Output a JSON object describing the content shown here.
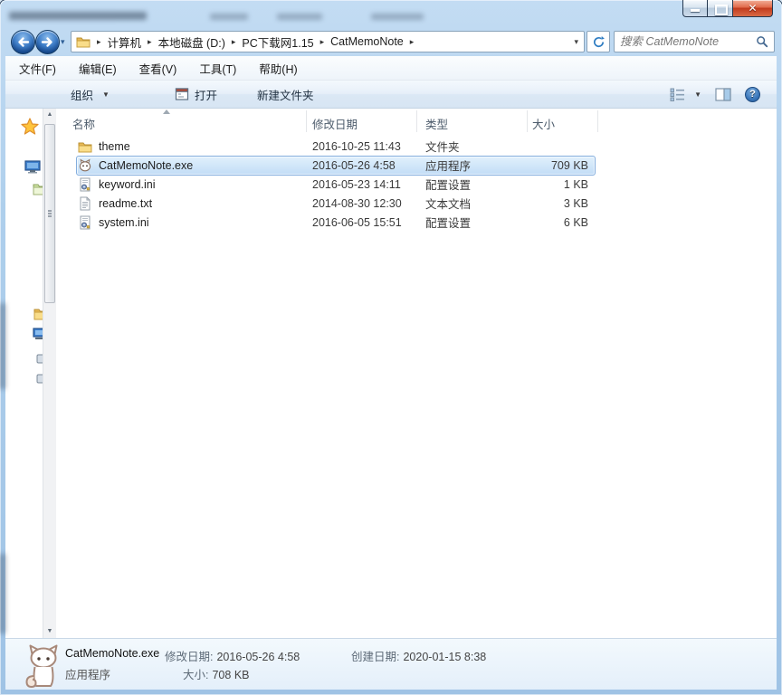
{
  "window": {
    "note": "title text is blurred/illegible in source"
  },
  "address_bar": {
    "breadcrumb": {
      "folder_icon": "folder-icon",
      "items": [
        {
          "label": "计算机"
        },
        {
          "label": "本地磁盘 (D:)"
        },
        {
          "label": "PC下载网1.15"
        },
        {
          "label": "CatMemoNote"
        }
      ]
    },
    "search_placeholder": "搜索 CatMemoNote"
  },
  "menu_bar": {
    "items": [
      "文件(F)",
      "编辑(E)",
      "查看(V)",
      "工具(T)",
      "帮助(H)"
    ]
  },
  "toolbar": {
    "organize_label": "组织",
    "open_label": "打开",
    "new_folder_label": "新建文件夹",
    "right_icons": [
      "views-icon",
      "preview-pane-icon",
      "help-icon"
    ]
  },
  "sidebar": {
    "icons": [
      "favorites-star-icon",
      "desktop-icon",
      "libraries-icon",
      "folder-icon",
      "computer-icon"
    ]
  },
  "file_list": {
    "columns": [
      "名称",
      "修改日期",
      "类型",
      "大小"
    ],
    "sort": {
      "column": "名称",
      "direction": "ascending"
    },
    "files": [
      {
        "name": "theme",
        "date": "2016-10-25 11:43",
        "type": "文件夹",
        "size": "",
        "icon": "folder-icon",
        "selected": false
      },
      {
        "name": "CatMemoNote.exe",
        "date": "2016-05-26 4:58",
        "type": "应用程序",
        "size": "709 KB",
        "icon": "cat-app-icon",
        "selected": true
      },
      {
        "name": "keyword.ini",
        "date": "2016-05-23 14:11",
        "type": "配置设置",
        "size": "1 KB",
        "icon": "ini-config-icon",
        "selected": false
      },
      {
        "name": "readme.txt",
        "date": "2014-08-30 12:30",
        "type": "文本文档",
        "size": "3 KB",
        "icon": "text-file-icon",
        "selected": false
      },
      {
        "name": "system.ini",
        "date": "2016-06-05 15:51",
        "type": "配置设置",
        "size": "6 KB",
        "icon": "ini-config-icon",
        "selected": false
      }
    ]
  },
  "details_pane": {
    "file_name": "CatMemoNote.exe",
    "file_type": "应用程序",
    "modified_label": "修改日期:",
    "modified_value": "2016-05-26 4:58",
    "created_label": "创建日期:",
    "created_value": "2020-01-15 8:38",
    "size_label": "大小:",
    "size_value": "708 KB"
  },
  "colors": {
    "aero_blue": "#aecfec",
    "selection_bg": "#c2ddf6",
    "selection_border": "#84aede",
    "close_red": "#c13a1d"
  }
}
